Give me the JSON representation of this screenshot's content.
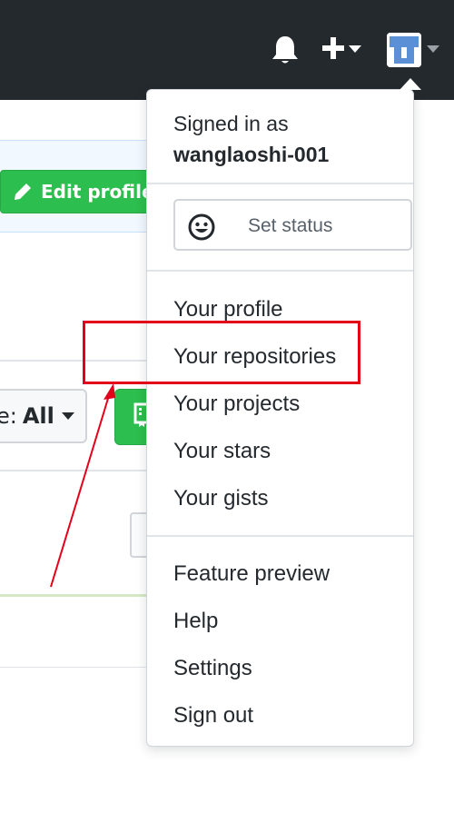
{
  "header": {
    "icons": [
      "bell-icon",
      "plus-icon",
      "caret-down-icon",
      "avatar-icon"
    ],
    "background_color": "#24292e"
  },
  "background": {
    "edit_profile_label": "Edit profile",
    "type_filter_prefix": "e:",
    "type_filter_value": "All",
    "new_button_icon": "repo-icon"
  },
  "menu": {
    "signed_in_as": "Signed in as",
    "username": "wanglaoshi-001",
    "set_status": "Set status",
    "items_primary": [
      "Your profile",
      "Your repositories",
      "Your projects",
      "Your stars",
      "Your gists"
    ],
    "items_secondary": [
      "Feature preview",
      "Help",
      "Settings",
      "Sign out"
    ]
  },
  "annotation": {
    "highlight_color": "#e3001b",
    "highlight_target": "Your repositories"
  },
  "colors": {
    "accent_green": "#2cbe4e",
    "text": "#24292e",
    "muted": "#586069",
    "border": "#d1d5da"
  }
}
